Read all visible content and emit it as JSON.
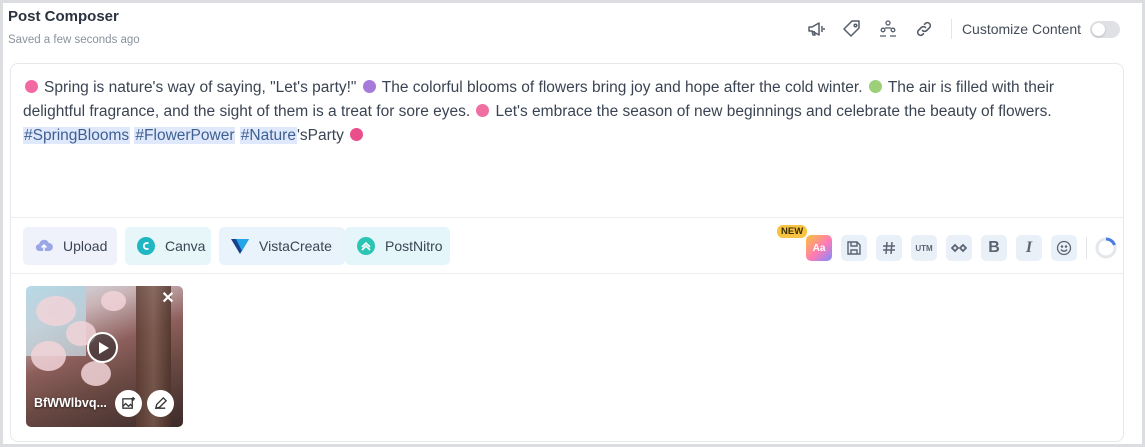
{
  "header": {
    "title": "Post Composer",
    "saved_status": "Saved a few seconds ago",
    "icons": [
      "megaphone-icon",
      "tag-icon",
      "people-icon",
      "link-icon"
    ],
    "customize_label": "Customize Content",
    "customize_enabled": false
  },
  "editor": {
    "line1": "Spring is nature's way of saying, \"Let's party!\"",
    "line2": "The colorful blooms of flowers bring joy and hope after the cold winter.",
    "line3": "The air is filled with their delightful fragrance, and the sight of them is a treat for sore eyes.",
    "line4": "Let's embrace the season of new beginnings and celebrate the beauty of flowers.",
    "hashtag1": "#SpringBlooms",
    "hashtag2": "#FlowerPower",
    "hashtag3": "#Nature",
    "tail": "'sParty"
  },
  "toolbar": {
    "upload_label": "Upload",
    "canva_label": "Canva",
    "vista_label": "VistaCreate",
    "nitro_label": "PostNitro",
    "new_badge": "NEW",
    "ai_label": "Aa",
    "utm_label": "UTM",
    "bold_label": "B",
    "italic_label": "I"
  },
  "media": {
    "file_name": "BfWWlbvq..."
  },
  "colors": {
    "accent": "#4c7de0",
    "hashtag_bg": "#dfe9fb",
    "new_badge": "#f6c343"
  }
}
